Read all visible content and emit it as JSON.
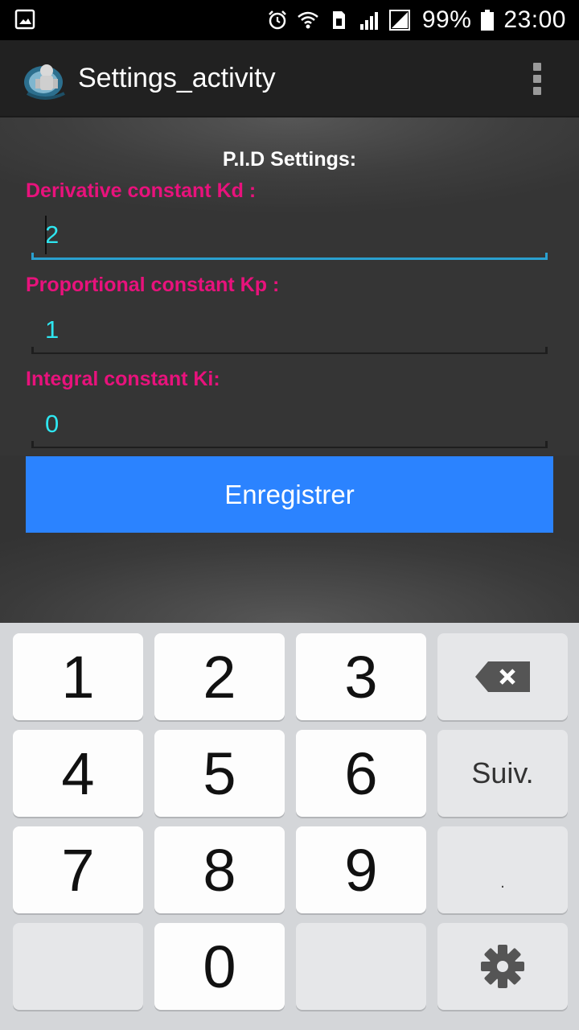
{
  "status_bar": {
    "battery_percent": "99%",
    "time": "23:00",
    "icons": [
      "image-icon",
      "alarm-icon",
      "wifi-icon",
      "sim-icon",
      "signal-icon",
      "signal-icon-2",
      "battery-icon"
    ]
  },
  "action_bar": {
    "title": "Settings_activity",
    "logo_icon": "app-logo-icon",
    "menu_icon": "overflow-menu-icon"
  },
  "form": {
    "section_title": "P.I.D Settings:",
    "fields": [
      {
        "label": "Derivative constant Kd :",
        "value": "2",
        "focused": true
      },
      {
        "label": "Proportional constant Kp :",
        "value": "1",
        "focused": false
      },
      {
        "label": "Integral constant Ki:",
        "value": "0",
        "focused": false
      }
    ],
    "save_label": "Enregistrer"
  },
  "keyboard": {
    "keys": {
      "k1": "1",
      "k2": "2",
      "k3": "3",
      "k4": "4",
      "k5": "5",
      "k6": "6",
      "k7": "7",
      "k8": "8",
      "k9": "9",
      "k0": "0",
      "next": "Suiv.",
      "dot": "."
    },
    "icons": [
      "backspace-icon",
      "gear-icon"
    ]
  },
  "colors": {
    "label": "#e8127c",
    "value": "#2ee6f0",
    "button": "#2b83ff",
    "focus_line": "#2aa0cf"
  }
}
